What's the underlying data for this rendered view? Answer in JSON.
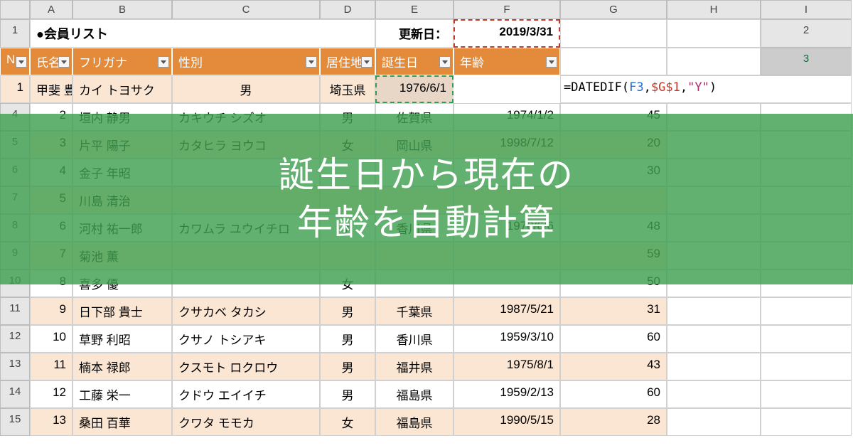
{
  "columns": [
    "A",
    "B",
    "C",
    "D",
    "E",
    "F",
    "G",
    "H",
    "I"
  ],
  "rowNums": [
    "1",
    "2",
    "3",
    "4",
    "5",
    "6",
    "7",
    "8",
    "9",
    "10",
    "11",
    "12",
    "13",
    "14",
    "15"
  ],
  "title": "●会員リスト",
  "updateLabel": "更新日：",
  "updateDate": "2019/3/31",
  "headers": {
    "no": "No",
    "name": "氏名",
    "kana": "フリガナ",
    "sex": "性別",
    "pref": "居住地",
    "birth": "誕生日",
    "age": "年齢"
  },
  "formula": {
    "eq": "=",
    "fn": "DATEDIF",
    "open": "(",
    "ref1": "F3",
    "comma1": ",",
    "ref2": "$G$1",
    "comma2": ",",
    "str": "\"Y\"",
    "close": ")"
  },
  "rows": [
    {
      "no": "1",
      "name": "甲斐 豊作",
      "kana": "カイ トヨサク",
      "sex": "男",
      "pref": "埼玉県",
      "birth": "1976/6/1",
      "age": ""
    },
    {
      "no": "2",
      "name": "垣内 静男",
      "kana": "カキウチ シズオ",
      "sex": "男",
      "pref": "佐賀県",
      "birth": "1974/1/2",
      "age": "45"
    },
    {
      "no": "3",
      "name": "片平 陽子",
      "kana": "カタヒラ ヨウコ",
      "sex": "女",
      "pref": "岡山県",
      "birth": "1998/7/12",
      "age": "20"
    },
    {
      "no": "4",
      "name": "金子 年昭",
      "kana": "",
      "sex": "",
      "pref": "",
      "birth": "",
      "age": "30"
    },
    {
      "no": "5",
      "name": "川島 清治",
      "kana": "",
      "sex": "",
      "pref": "",
      "birth": "",
      "age": ""
    },
    {
      "no": "6",
      "name": "河村 祐一郎",
      "kana": "カワムラ ユウイチロ",
      "sex": "男",
      "pref": "香川県",
      "birth": "1970/6/6",
      "age": "48"
    },
    {
      "no": "7",
      "name": "菊池 薫",
      "kana": "",
      "sex": "",
      "pref": "",
      "birth": "",
      "age": "59"
    },
    {
      "no": "8",
      "name": "喜多 優",
      "kana": "",
      "sex": "女",
      "pref": "",
      "birth": "",
      "age": "50"
    },
    {
      "no": "9",
      "name": "日下部 貴士",
      "kana": "クサカベ タカシ",
      "sex": "男",
      "pref": "千葉県",
      "birth": "1987/5/21",
      "age": "31"
    },
    {
      "no": "10",
      "name": "草野 利昭",
      "kana": "クサノ トシアキ",
      "sex": "男",
      "pref": "香川県",
      "birth": "1959/3/10",
      "age": "60"
    },
    {
      "no": "11",
      "name": "楠本 禄郎",
      "kana": "クスモト ロクロウ",
      "sex": "男",
      "pref": "福井県",
      "birth": "1975/8/1",
      "age": "43"
    },
    {
      "no": "12",
      "name": "工藤 栄一",
      "kana": "クドウ エイイチ",
      "sex": "男",
      "pref": "福島県",
      "birth": "1959/2/13",
      "age": "60"
    },
    {
      "no": "13",
      "name": "桑田 百華",
      "kana": "クワタ モモカ",
      "sex": "女",
      "pref": "福島県",
      "birth": "1990/5/15",
      "age": "28"
    }
  ],
  "overlay": {
    "line1": "誕生日から現在の",
    "line2": "年齢を自動計算"
  }
}
